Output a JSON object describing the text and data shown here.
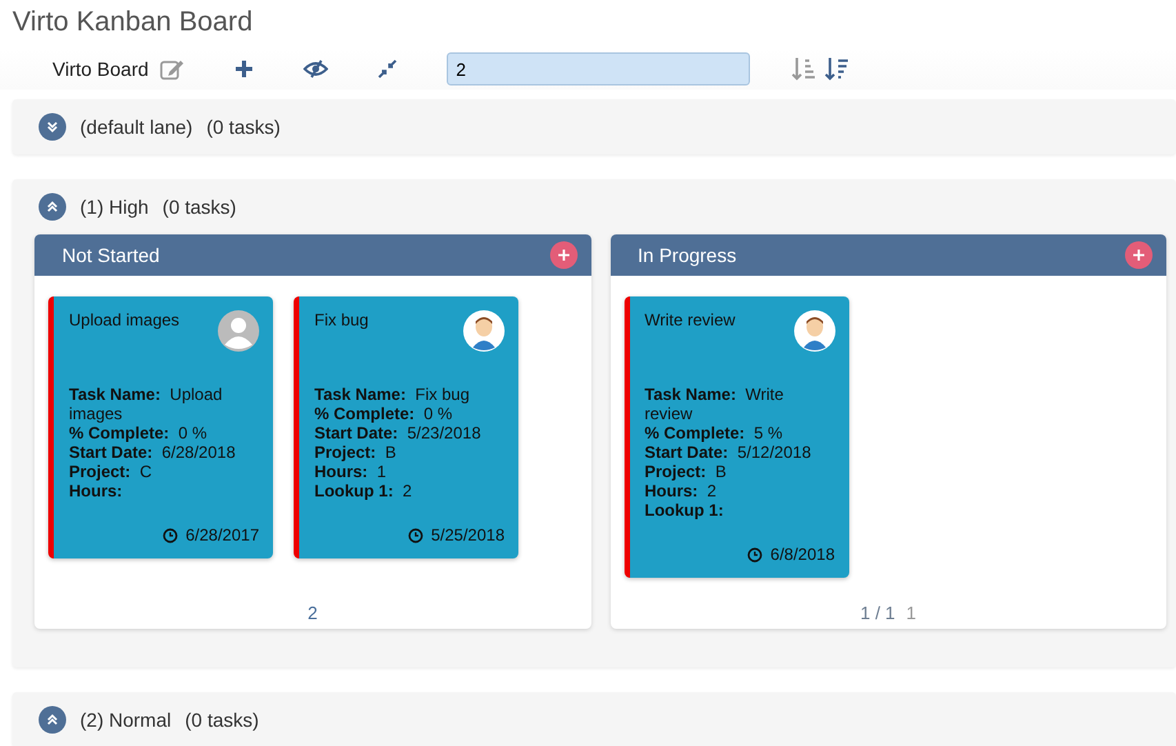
{
  "title": "Virto Kanban Board",
  "toolbar": {
    "board_name": "Virto Board",
    "search_value": "2"
  },
  "lanes": [
    {
      "name": "(default lane)",
      "count": "(0 tasks)",
      "expanded": false
    },
    {
      "name": "(1) High",
      "count": "(0 tasks)",
      "expanded": true,
      "columns": [
        {
          "title": "Not Started",
          "footer": [
            "2"
          ],
          "cards": [
            {
              "title": "Upload images",
              "kind": "placeholder",
              "fields": [
                {
                  "label": "Task Name:",
                  "value": "Upload images"
                },
                {
                  "label": "% Complete:",
                  "value": "0 %"
                },
                {
                  "label": "Start Date:",
                  "value": "6/28/2018"
                },
                {
                  "label": "Project:",
                  "value": "C"
                },
                {
                  "label": "Hours:"
                }
              ],
              "due": "6/28/2017"
            },
            {
              "title": "Fix bug",
              "kind": "person",
              "fields": [
                {
                  "label": "Task Name:",
                  "value": "Fix bug"
                },
                {
                  "label": "% Complete:",
                  "value": "0 %"
                },
                {
                  "label": "Start Date:",
                  "value": "5/23/2018"
                },
                {
                  "label": "Project:",
                  "value": "B"
                },
                {
                  "label": "Hours:",
                  "value": "1"
                },
                {
                  "label": "Lookup 1:",
                  "value": "2"
                }
              ],
              "due": "5/25/2018"
            }
          ]
        },
        {
          "title": "In Progress",
          "footer": [
            "1 / 1",
            "1"
          ],
          "cards": [
            {
              "title": "Write review",
              "kind": "person",
              "fields": [
                {
                  "label": "Task Name:",
                  "value": "Write review"
                },
                {
                  "label": "% Complete:",
                  "value": "5 %"
                },
                {
                  "label": "Start Date:",
                  "value": "5/12/2018"
                },
                {
                  "label": "Project:",
                  "value": "B"
                },
                {
                  "label": "Hours:",
                  "value": "2"
                },
                {
                  "label": "Lookup 1:"
                }
              ],
              "due": "6/8/2018"
            }
          ]
        }
      ]
    },
    {
      "name": "(2) Normal",
      "count": "(0 tasks)",
      "expanded": true
    }
  ]
}
